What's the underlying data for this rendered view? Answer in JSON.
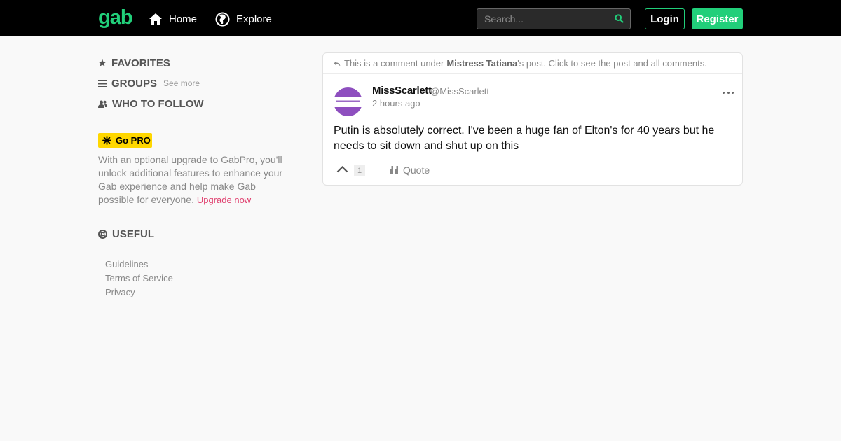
{
  "nav": {
    "logo": "gab",
    "home_label": "Home",
    "explore_label": "Explore",
    "search_placeholder": "Search...",
    "login_label": "Login",
    "register_label": "Register"
  },
  "sidebar": {
    "favorites_label": "FAVORITES",
    "groups_label": "GROUPS",
    "groups_see_more": "See more",
    "who_to_follow_label": "WHO TO FOLLOW",
    "gopro_badge": "Go PRO",
    "gopro_text": "With an optional upgrade to GabPro, you'll unlock additional features to enhance your Gab experience and help make Gab possible for everyone.",
    "upgrade_link": "Upgrade now",
    "useful_label": "USEFUL",
    "useful_links": [
      "Guidelines",
      "Terms of Service",
      "Privacy"
    ]
  },
  "post": {
    "comment_prefix": "This is a comment under",
    "parent_author": "Mistress Tatiana",
    "comment_suffix": "'s post. Click to see the post and all comments.",
    "author_name": "MissScarlett",
    "author_handle": "@MissScarlett",
    "time": "2 hours ago",
    "body": "Putin is absolutely correct. I've been a huge fan of Elton's for 40 years but he needs to sit down and shut up on this",
    "vote_count": "1",
    "quote_label": "Quote"
  },
  "colors": {
    "brand": "#21cf7a",
    "topbar": "#000000",
    "gopro": "#ffd700",
    "upgrade_link": "#e0406f",
    "avatar_accent": "#8e4fbf"
  }
}
